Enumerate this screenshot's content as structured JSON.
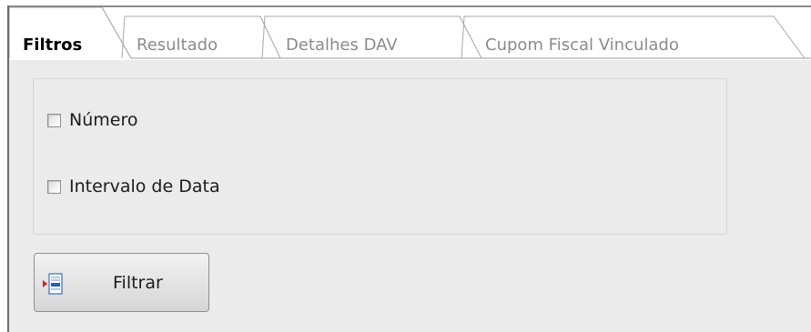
{
  "tabs": [
    {
      "label": "Filtros",
      "active": true
    },
    {
      "label": "Resultado",
      "active": false
    },
    {
      "label": "Detalhes DAV",
      "active": false
    },
    {
      "label": "Cupom Fiscal Vinculado",
      "active": false
    }
  ],
  "filters": {
    "numero": {
      "label": "Número",
      "checked": false
    },
    "intervalo": {
      "label": "Intervalo de Data",
      "checked": false
    }
  },
  "button": {
    "label": "Filtrar",
    "icon": "filter-list-icon"
  },
  "colors": {
    "content_bg": "#ebebeb",
    "active_text": "#000000",
    "inactive_text": "#8b8b8b",
    "icon_blue": "#1f5fbf",
    "icon_red": "#d32020"
  }
}
